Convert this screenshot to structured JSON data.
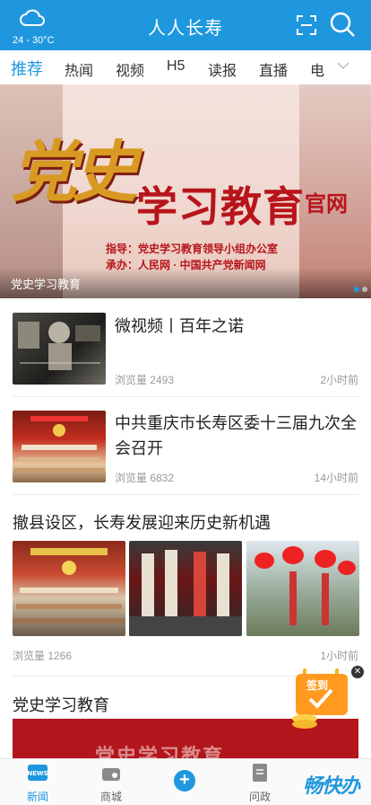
{
  "header": {
    "weather_icon": "cloud-icon",
    "temperature": "24 - 30°C",
    "title": "人人长寿",
    "scan_icon": "scan-icon",
    "search_icon": "search-icon",
    "color": "#1f97de"
  },
  "tabs": [
    {
      "label": "推荐",
      "active": true
    },
    {
      "label": "热闻"
    },
    {
      "label": "视频"
    },
    {
      "label": "H5"
    },
    {
      "label": "读报"
    },
    {
      "label": "直播"
    },
    {
      "label": "电"
    }
  ],
  "banner": {
    "headline_big": "党史",
    "headline_main": "学习教育",
    "headline_suffix": "官网",
    "line1": "指导：党史学习教育领导小组办公室",
    "line2": "承办：人民网 · 中国共产党新闻网",
    "caption": "党史学习教育"
  },
  "news": [
    {
      "title": "微视频丨百年之诺",
      "views": "浏览量 2493",
      "time": "2小时前"
    },
    {
      "title": "中共重庆市长寿区委十三届九次全会召开",
      "views": "浏览量 6832",
      "time": "14小时前"
    }
  ],
  "gallery_item": {
    "title": "撤县设区，长寿发展迎来历史新机遇",
    "views": "浏览量 1266",
    "time": "1小时前"
  },
  "section": {
    "title": "党史学习教育",
    "banner_text": "党史学习教育"
  },
  "checkin": {
    "label": "签到"
  },
  "bottom_nav": [
    {
      "label": "新闻",
      "active": true
    },
    {
      "label": "商城"
    },
    {
      "label": "问政"
    }
  ],
  "brand": "畅快办"
}
